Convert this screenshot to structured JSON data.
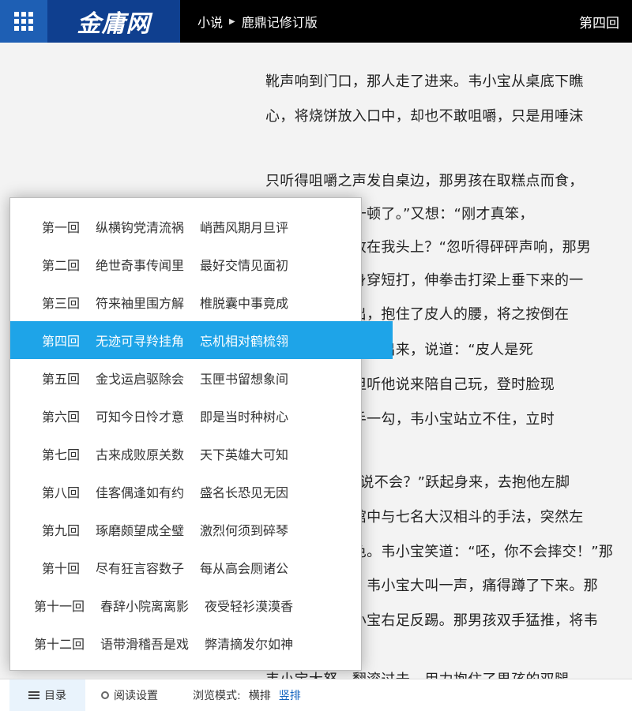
{
  "header": {
    "logo_text": "金庸网",
    "breadcrumb": [
      "小说",
      "鹿鼎记修订版"
    ],
    "chapter": "第四回"
  },
  "content": {
    "paragraphs": [
      "靴声响到门口，那人走了进来。韦小宝从桌底下瞧",
      "心，将烧饼放入口中，却也不敢咀嚼，只是用唾沫",
      "只听得咀嚼之声发自桌边，那男孩在取糕点而食，",
      "吃，这便大嚼一顿了。”又想：“刚才真笨，",
      "既然是把猴子放在我头上？“忽听得砰砰声响，那男",
      "四五岁年纪，身穿短打，伸拳击打梁上垂下来的一",
      "了一个双臂伸出，抱住了皮人的腰，将之按倒在",
      "韦小宝从桌底钻了出来，说道：“皮人是死",
      "那男孩一惊，但听他说来陪自己玩，登时脸现",
      "左手一抓，右手一勾，韦小宝站立不住，立时",
      "韦小宝道：“谁说不会？”跃起身来，去抱他左脚",
      "跟着使出在酒馆中与七名大汉相斗的手法，突然左",
      "厉害，露出笑色。韦小宝笑道：“呸，你不会摔交！”那",
      "右足在他腿里，韦小宝大叫一声，痛得蹲了下来。那",
      "男孩大怒。韦小宝右足反踢。那男孩双手猛推，将韦",
      "韦小宝大怒，翻滚过去，用力抱住了男孩的双腿，"
    ]
  },
  "toc": {
    "items": [
      {
        "no": "第一回",
        "t1": "纵横钩党清流祸",
        "t2": "峭茜风期月旦评"
      },
      {
        "no": "第二回",
        "t1": "绝世奇事传闻里",
        "t2": "最好交情见面初"
      },
      {
        "no": "第三回",
        "t1": "符来袖里围方解",
        "t2": "椎脱囊中事竟成"
      },
      {
        "no": "第四回",
        "t1": "无迹可寻羚挂角",
        "t2": "忘机相对鹤梳翎"
      },
      {
        "no": "第五回",
        "t1": "金戈运启驱除会",
        "t2": "玉匣书留想象间"
      },
      {
        "no": "第六回",
        "t1": "可知今日怜才意",
        "t2": "即是当时种树心"
      },
      {
        "no": "第七回",
        "t1": "古来成败原关数",
        "t2": "天下英雄大可知"
      },
      {
        "no": "第八回",
        "t1": "佳客偶逢如有约",
        "t2": "盛名长恐见无因"
      },
      {
        "no": "第九回",
        "t1": "琢磨颇望成全璧",
        "t2": "激烈何须到碎琴"
      },
      {
        "no": "第十回",
        "t1": "尽有狂言容数子",
        "t2": "每从高会厕诸公"
      },
      {
        "no": "第十一回",
        "t1": "春辞小院离离影",
        "t2": "夜受轻衫漠漠香"
      },
      {
        "no": "第十二回",
        "t1": "语带滑稽吾是戏",
        "t2": "弊清摘发尔如神"
      }
    ],
    "active_index": 3
  },
  "bottombar": {
    "toc_label": "目录",
    "settings_label": "阅读设置",
    "mode_label": "浏览模式:",
    "mode_options": [
      "横排",
      "竖排"
    ],
    "mode_selected": "竖排"
  },
  "colors": {
    "topbar": "#000000",
    "menu_button": "#1e5fb4",
    "logo_bg": "#0f3f8f",
    "toc_active": "#1ea4e8",
    "mode_selected": "#1565c0"
  },
  "icons": {
    "menu": "grid-icon",
    "toc": "list-icon",
    "settings": "gear-icon",
    "breadcrumb_separator": "triangle-right-icon"
  }
}
